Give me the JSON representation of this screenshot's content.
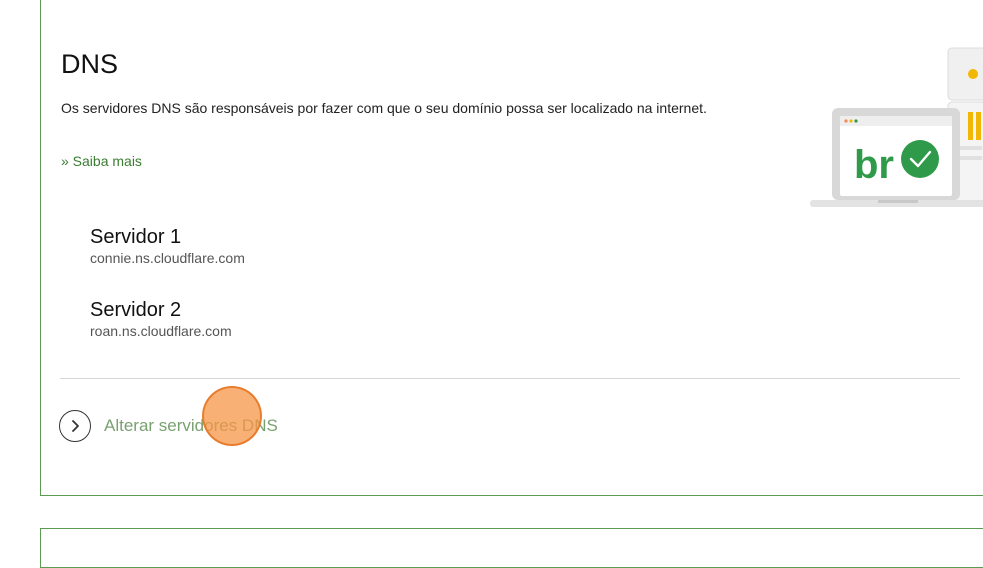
{
  "dns_section": {
    "title": "DNS",
    "description": "Os servidores DNS são responsáveis por fazer com que o seu domínio possa ser localizado na internet.",
    "learn_more": "» Saiba mais",
    "servers": [
      {
        "label": "Servidor 1",
        "host": "connie.ns.cloudflare.com"
      },
      {
        "label": "Servidor 2",
        "host": "roan.ns.cloudflare.com"
      }
    ],
    "action_label": "Alterar servidores DNS",
    "illustration_text": "br"
  },
  "colors": {
    "accent_green": "#3a7d33",
    "border_green": "#5a9a52",
    "check_green": "#2e9a4a",
    "cursor_highlight": "#f79646"
  },
  "icons": {
    "action": "chevron-right-circle-icon",
    "illustration": "laptop-check-illustration"
  }
}
